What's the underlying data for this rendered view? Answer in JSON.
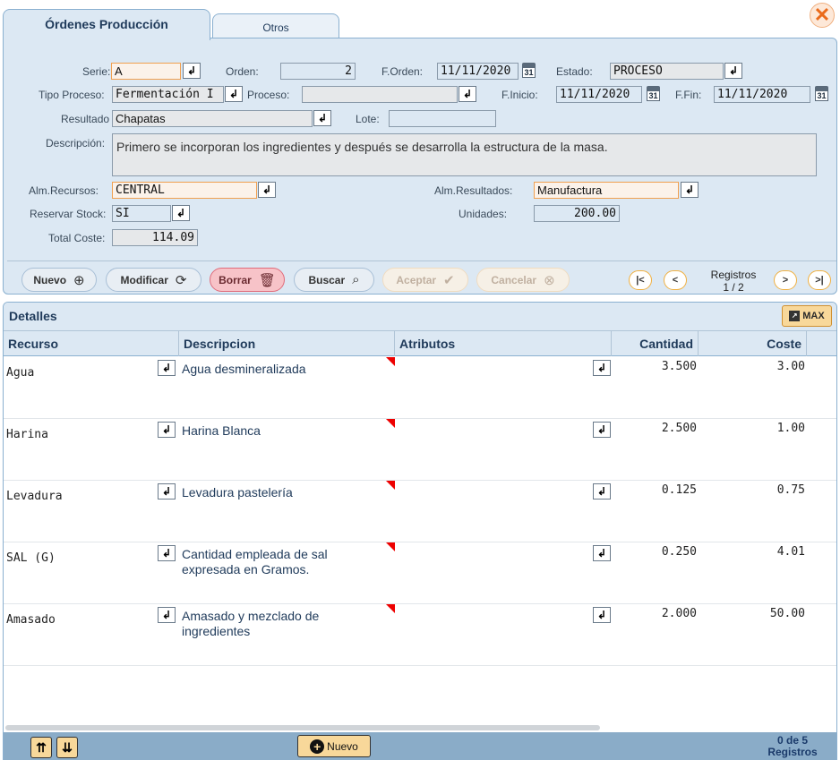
{
  "tabs": [
    {
      "label": "Órdenes Producción",
      "active": true
    },
    {
      "label": "Otros",
      "active": false
    }
  ],
  "form": {
    "serie": {
      "label": "Serie:",
      "value": "A"
    },
    "orden": {
      "label": "Orden:",
      "value": "2"
    },
    "forden": {
      "label": "F.Orden:",
      "value": "11/11/2020"
    },
    "estado": {
      "label": "Estado:",
      "value": "PROCESO"
    },
    "tipo_proceso": {
      "label": "Tipo Proceso:",
      "value": "Fermentación I"
    },
    "proceso": {
      "label": "Proceso:",
      "value": ""
    },
    "finicio": {
      "label": "F.Inicio:",
      "value": "11/11/2020"
    },
    "ffin": {
      "label": "F.Fin:",
      "value": "11/11/2020"
    },
    "resultado": {
      "label": "Resultado",
      "value": "Chapatas"
    },
    "lote": {
      "label": "Lote:",
      "value": ""
    },
    "descripcion": {
      "label": "Descripción:",
      "value": "Primero se incorporan los ingredientes y después se desarrolla la estructura de la masa."
    },
    "alm_recursos": {
      "label": "Alm.Recursos:",
      "value": "CENTRAL"
    },
    "alm_resultados": {
      "label": "Alm.Resultados:",
      "value": "Manufactura"
    },
    "reservar_stock": {
      "label": "Reservar Stock:",
      "value": "SI"
    },
    "unidades": {
      "label": "Unidades:",
      "value": "200.00"
    },
    "total_coste": {
      "label": "Total Coste:",
      "value": "114.09"
    },
    "calendar_day": "31"
  },
  "toolbar": {
    "nuevo": "Nuevo",
    "modificar": "Modificar",
    "borrar": "Borrar",
    "buscar": "Buscar",
    "aceptar": "Aceptar",
    "cancelar": "Cancelar",
    "registros_label": "Registros",
    "registros_value": "1 / 2"
  },
  "details": {
    "title": "Detalles",
    "max_label": "MAX",
    "columns": [
      "Recurso",
      "Descripcion",
      "Atributos",
      "Cantidad",
      "Coste"
    ],
    "rows": [
      {
        "recurso": "Agua",
        "descripcion": "Agua desmineralizada",
        "cantidad": "3.500",
        "coste": "3.00"
      },
      {
        "recurso": "Harina",
        "descripcion": "Harina Blanca",
        "cantidad": "2.500",
        "coste": "1.00"
      },
      {
        "recurso": "Levadura",
        "descripcion": "Levadura pastelería",
        "cantidad": "0.125",
        "coste": "0.75"
      },
      {
        "recurso": "SAL (G)",
        "descripcion": "Cantidad empleada de sal expresada en Gramos.",
        "cantidad": "0.250",
        "coste": "4.01"
      },
      {
        "recurso": "Amasado",
        "descripcion": "Amasado y mezclado de ingredientes",
        "cantidad": "2.000",
        "coste": "50.00"
      }
    ],
    "footer": {
      "nuevo": "Nuevo",
      "count_line1": "0 de 5",
      "count_line2": "Registros"
    }
  },
  "colors": {
    "panel_bg": "#dce8f3",
    "accent_orange": "#f0a050",
    "button_yellow": "#f8d89a",
    "danger": "#f7c3c8"
  },
  "icons": [
    "close-icon",
    "lookup-icon",
    "calendar-icon",
    "add-circle-icon",
    "refresh-icon",
    "trash-icon",
    "search-icon",
    "check-icon",
    "cancel-icon",
    "first-page-icon",
    "prev-page-icon",
    "next-page-icon",
    "last-page-icon",
    "maximize-icon",
    "move-top-icon",
    "move-bottom-icon",
    "plus-icon"
  ]
}
